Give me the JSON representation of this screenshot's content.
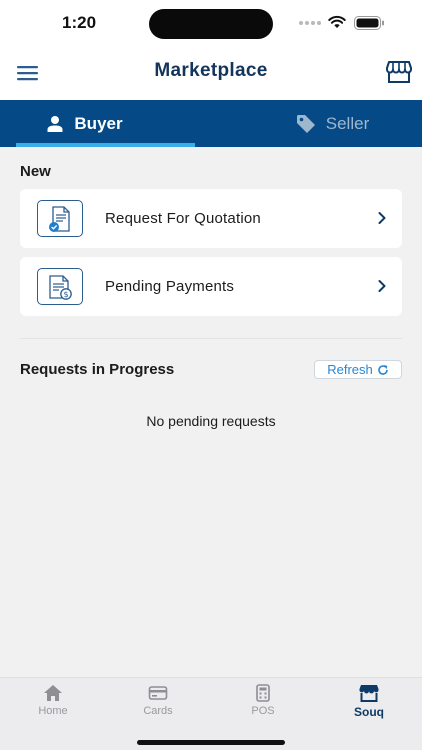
{
  "status_bar": {
    "time": "1:20"
  },
  "header": {
    "title": "Marketplace",
    "menu_icon": "menu-icon",
    "store_icon": "store-icon"
  },
  "tabs": [
    {
      "label": "Buyer",
      "icon": "user-icon",
      "active": true
    },
    {
      "label": "Seller",
      "icon": "tag-icon",
      "active": false
    }
  ],
  "new_section": {
    "title": "New",
    "items": [
      {
        "label": "Request For Quotation",
        "icon": "document-check-icon"
      },
      {
        "label": "Pending Payments",
        "icon": "invoice-dollar-icon"
      }
    ]
  },
  "progress_section": {
    "title": "Requests in Progress",
    "refresh_label": "Refresh",
    "empty_text": "No pending requests"
  },
  "bottom_nav": [
    {
      "label": "Home",
      "icon": "home-icon",
      "active": false
    },
    {
      "label": "Cards",
      "icon": "card-icon",
      "active": false
    },
    {
      "label": "POS",
      "icon": "calculator-icon",
      "active": false
    },
    {
      "label": "Souq",
      "icon": "store-icon",
      "active": true
    }
  ],
  "colors": {
    "primary": "#054a86",
    "title": "#13355c",
    "accent": "#3aaee8",
    "link": "#2a86d1"
  }
}
